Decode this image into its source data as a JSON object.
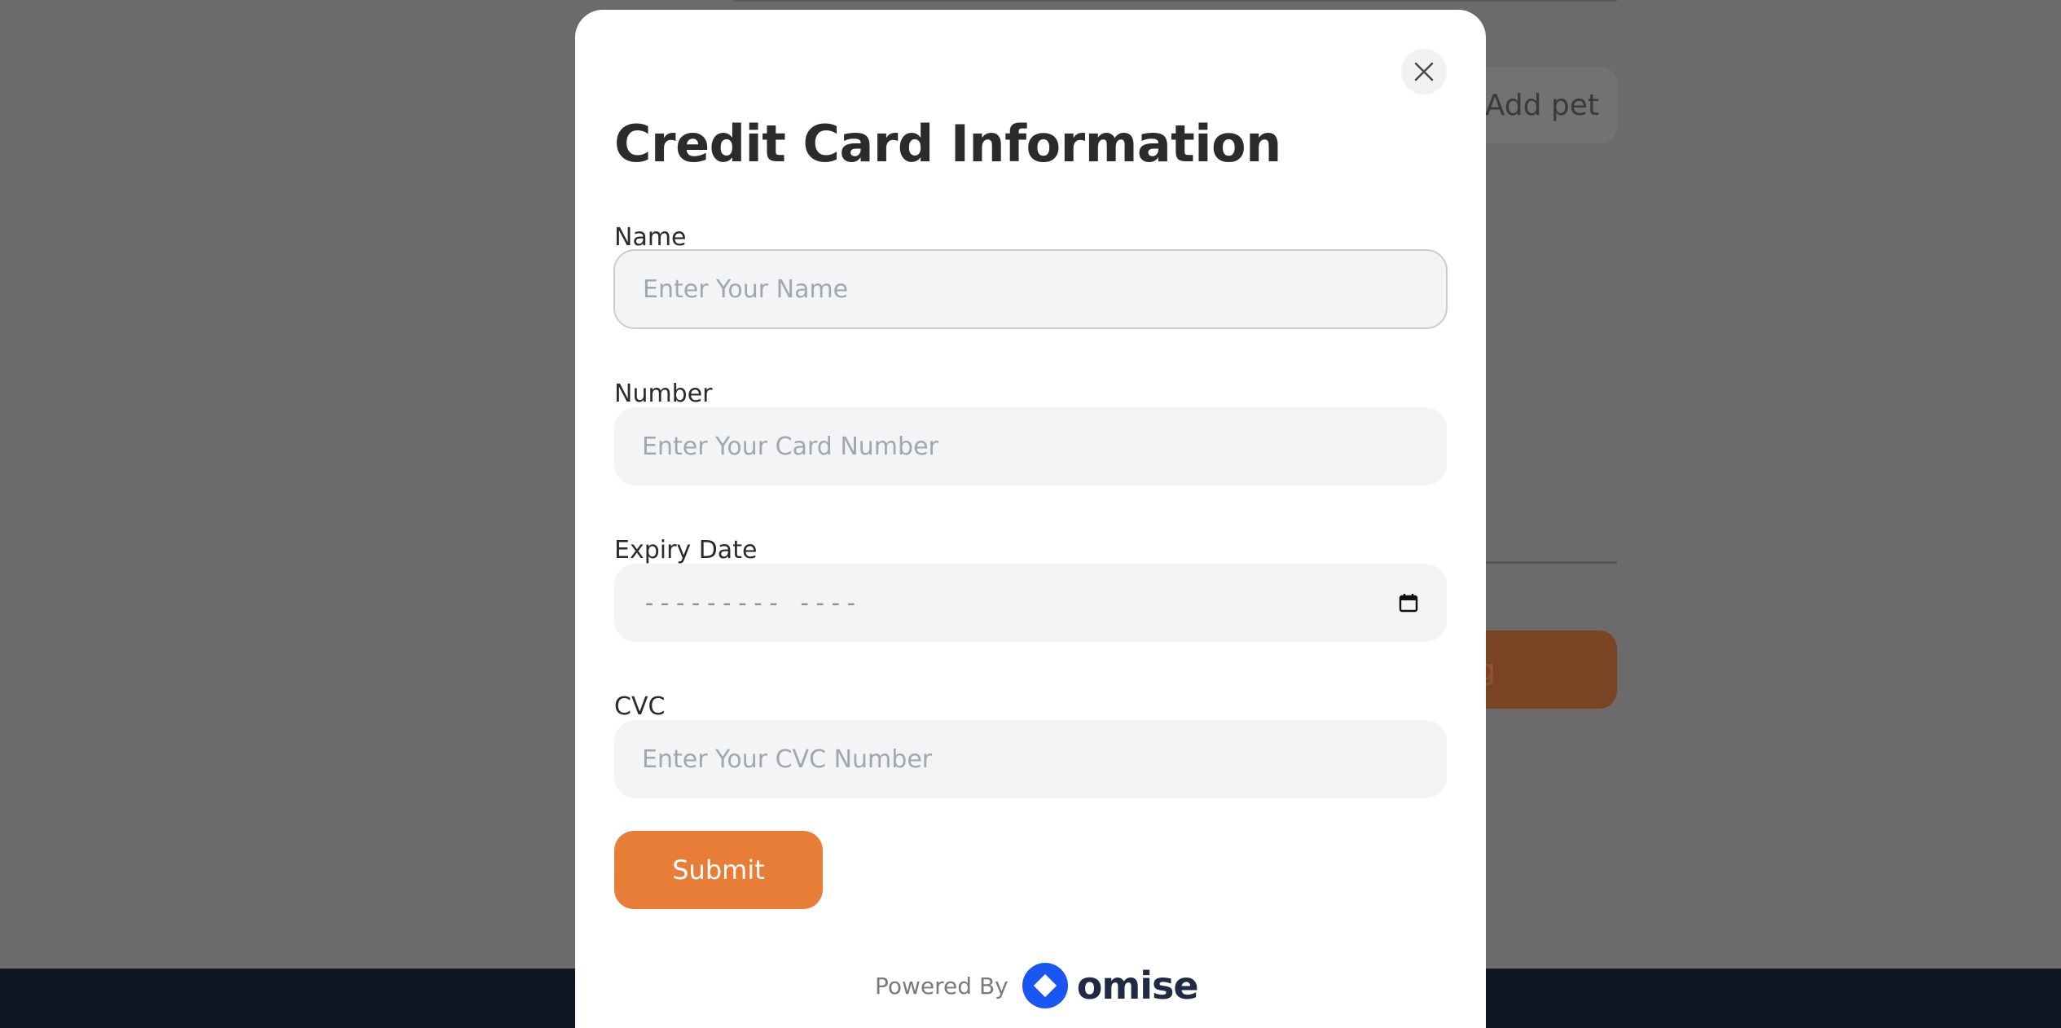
{
  "background": {
    "add_pet_label": "Add pet",
    "orange_button_label": "g"
  },
  "modal": {
    "title": "Credit Card Information",
    "close_icon": "close-icon",
    "fields": {
      "name": {
        "label": "Name",
        "placeholder": "Enter Your Name",
        "value": ""
      },
      "number": {
        "label": "Number",
        "placeholder": "Enter Your Card Number",
        "value": ""
      },
      "expiry": {
        "label": "Expiry Date",
        "placeholder": "--------- ----",
        "icon": "calendar-icon"
      },
      "cvc": {
        "label": "CVC",
        "placeholder": "Enter Your CVC Number",
        "value": ""
      }
    },
    "submit_label": "Submit",
    "footer": {
      "powered_by": "Powered By",
      "brand": "omise"
    }
  },
  "colors": {
    "accent": "#e87d37",
    "overlay": "#6b6b6b",
    "brand_blue": "#1a56f0"
  }
}
